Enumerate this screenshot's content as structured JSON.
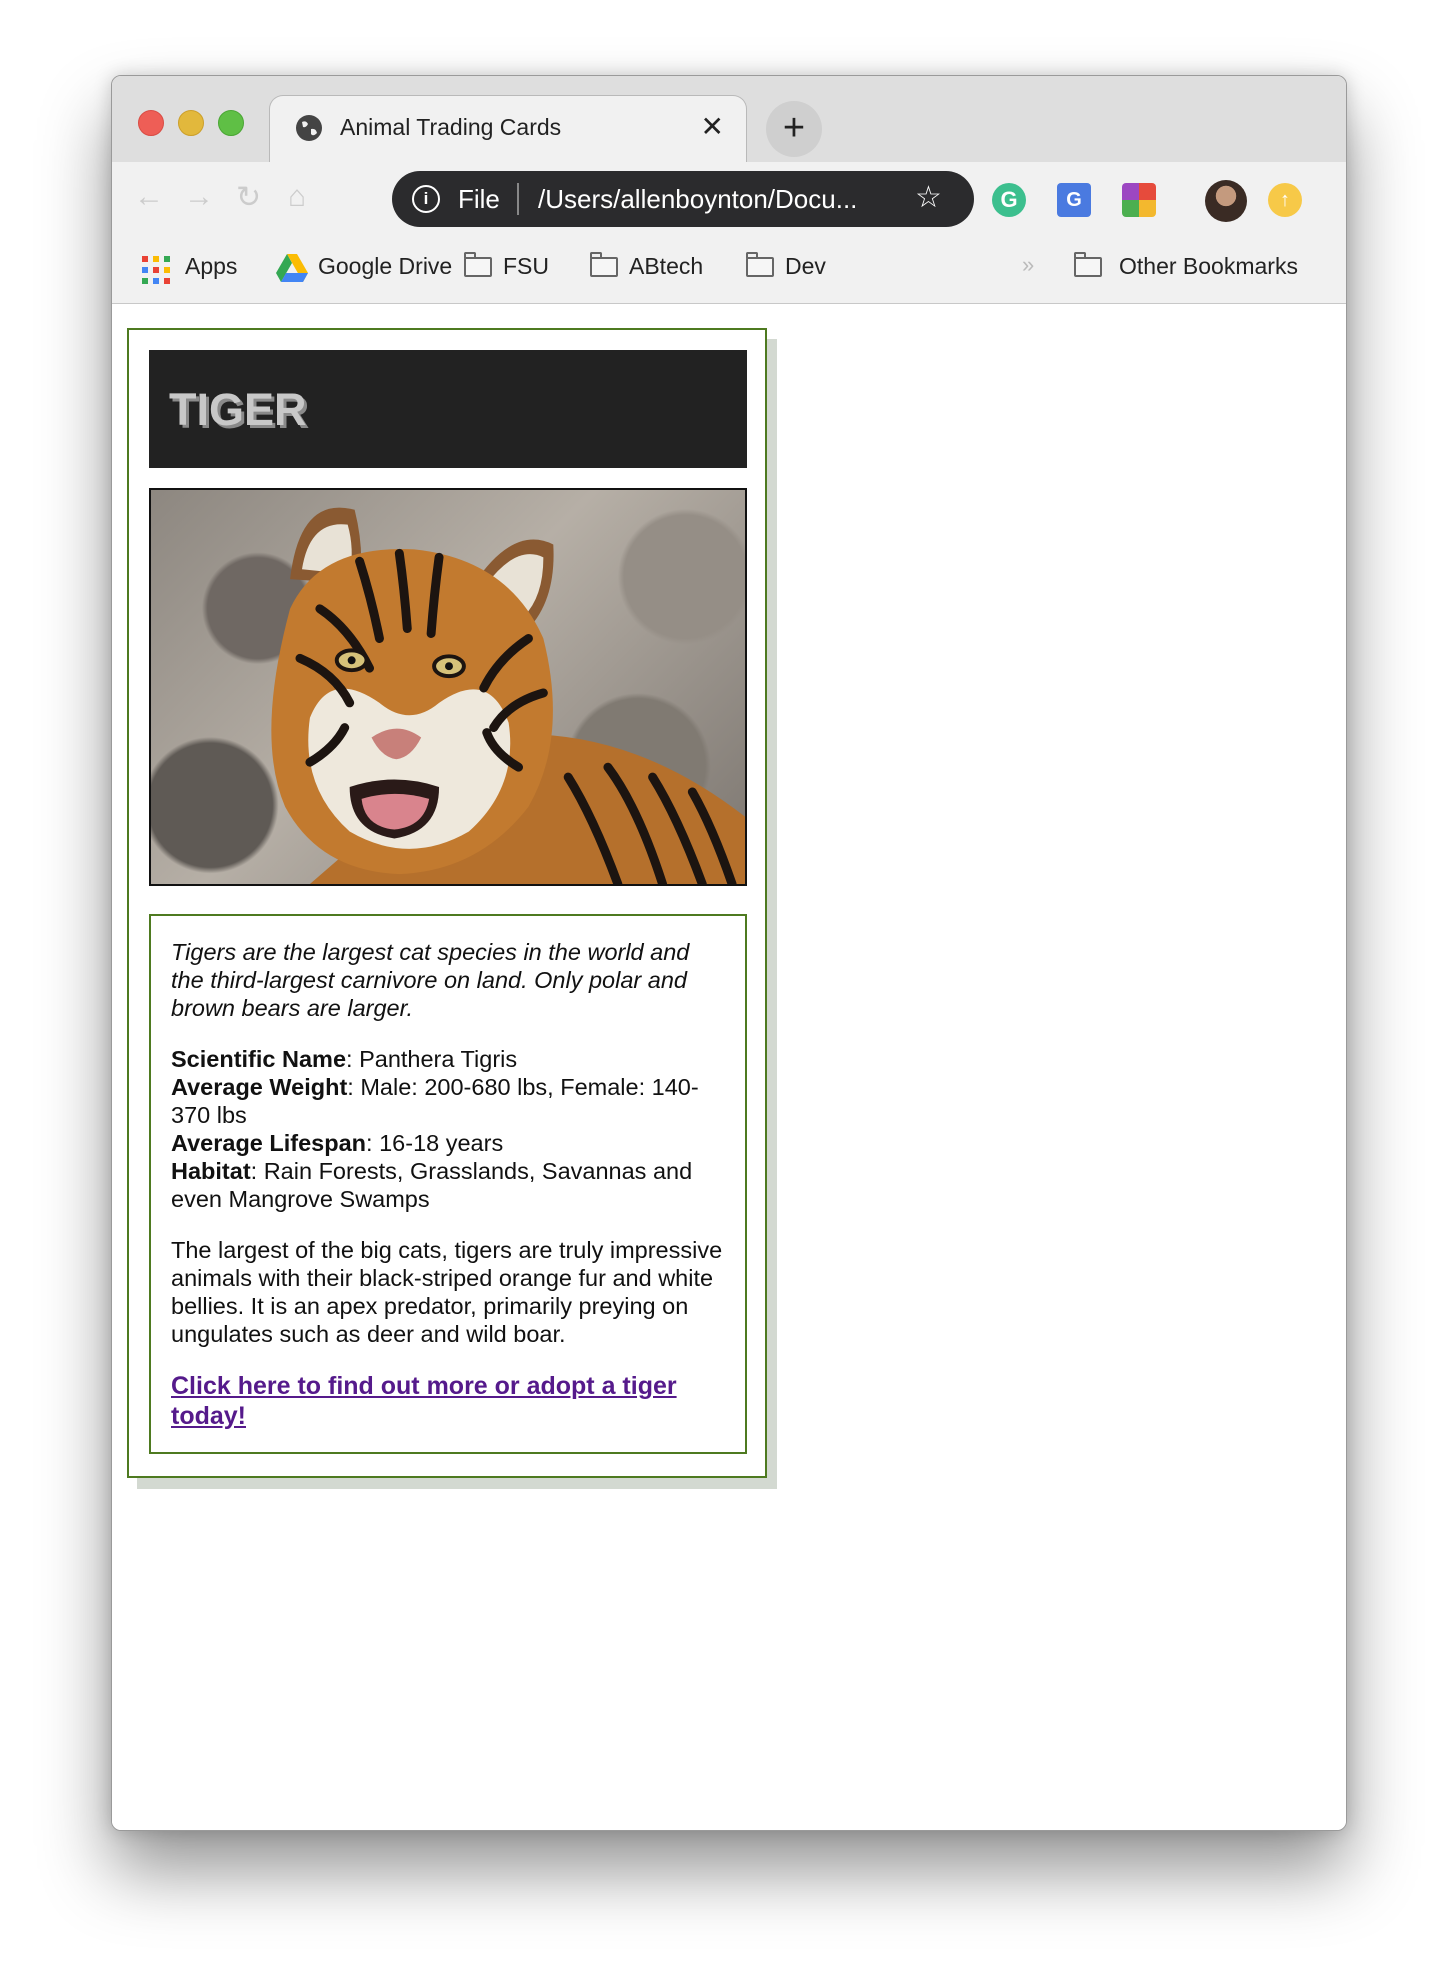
{
  "browser": {
    "tab_title": "Animal Trading Cards",
    "tab_close": "✕",
    "new_tab": "+",
    "url_scheme": "File",
    "url": "/Users/allenboynton/Docu...",
    "bookmarks": {
      "apps": "Apps",
      "google_drive": "Google Drive",
      "fsu": "FSU",
      "abtech": "ABtech",
      "dev": "Dev",
      "overflow": "»",
      "other": "Other Bookmarks"
    }
  },
  "card": {
    "title": "TIGER",
    "lead": "Tigers are the largest cat species in the world and the third-largest carnivore on land. Only polar and brown bears are larger.",
    "facts": [
      {
        "label": "Scientific Name",
        "value": ": Panthera Tigris"
      },
      {
        "label": "Average Weight",
        "value": ": Male: 200-680 lbs, Female: 140-370 lbs"
      },
      {
        "label": "Average Lifespan",
        "value": ": 16-18 years"
      },
      {
        "label": "Habitat",
        "value": ": Rain Forests, Grasslands, Savannas and even Mangrove Swamps"
      }
    ],
    "description": "The largest of the big cats, tigers are truly impressive animals with their black-striped orange fur and white bellies. It is an apex predator, primarily preying on ungulates such as deer and wild boar.",
    "link_text": "Click here to find out more or adopt a tiger today!"
  },
  "colors": {
    "card_border": "#4e7a20",
    "header_bg": "#222222",
    "link": "#551a8b"
  }
}
